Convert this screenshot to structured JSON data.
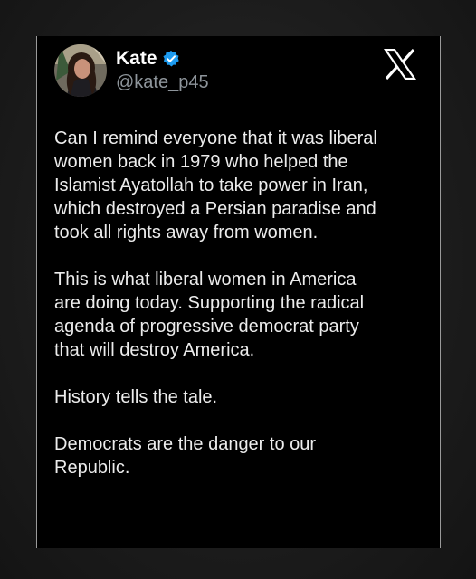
{
  "tweet": {
    "display_name": "Kate",
    "handle": "@kate_p45",
    "paragraphs": [
      "Can I remind everyone that it was liberal\nwomen back in 1979 who helped the\nIslamist Ayatollah to take power in Iran,\nwhich destroyed a Persian paradise and\ntook all rights away from women.",
      "This is what liberal women in America\nare doing today. Supporting the radical\nagenda of progressive democrat party\nthat will destroy America.",
      "History tells the tale.",
      "Democrats are the danger to our\nRepublic."
    ]
  },
  "icons": {
    "verified": "verified-badge-icon",
    "platform": "x-logo-icon"
  },
  "colors": {
    "card_background": "#000000",
    "text": "#ececec",
    "handle": "#8e959b",
    "verified_badge": "#1d9bf0",
    "page_background": "#1b1b1b"
  }
}
